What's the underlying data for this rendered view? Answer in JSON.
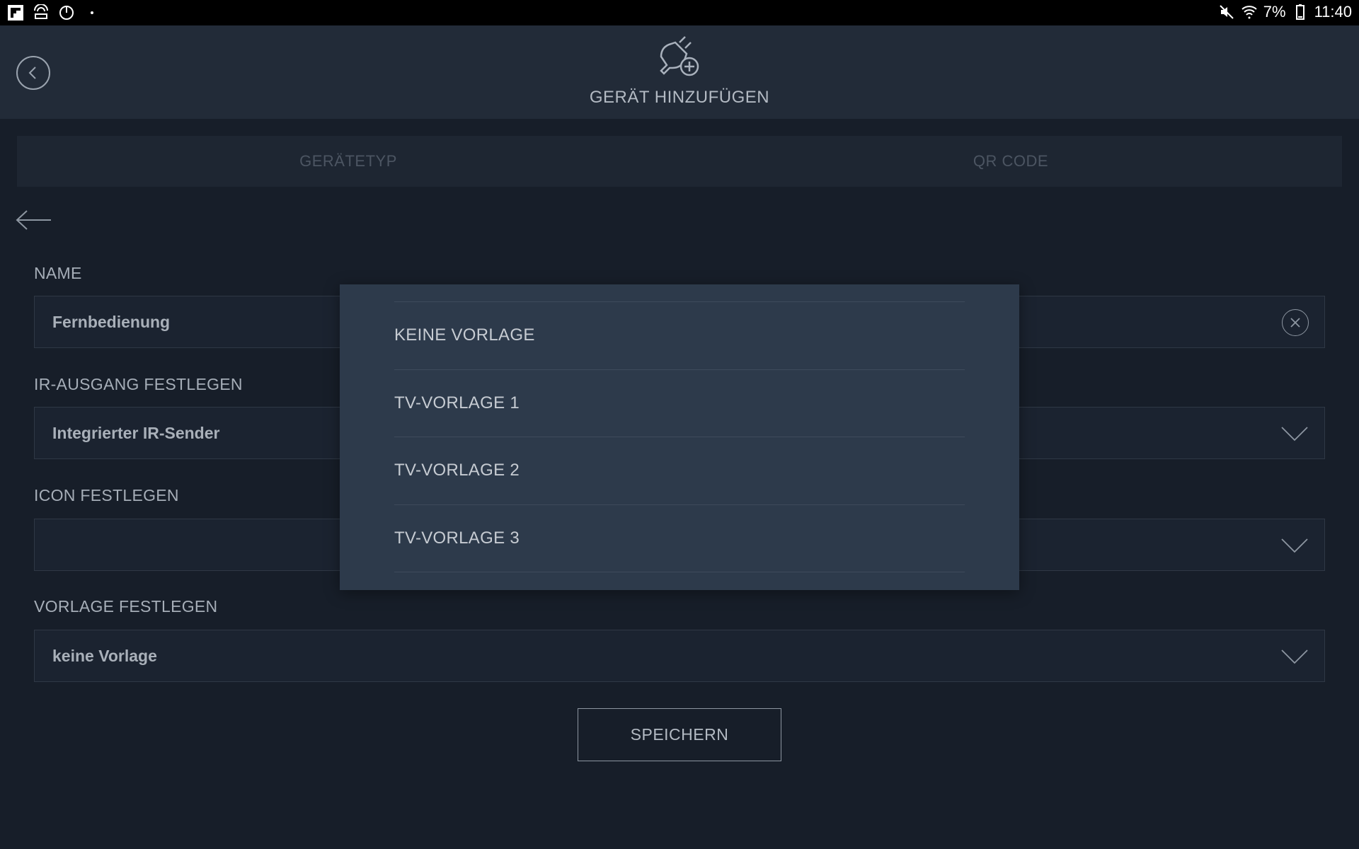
{
  "status_bar": {
    "left_icons": [
      "flipboard-icon",
      "screen-mirror-icon",
      "sync-icon",
      "dot-icon"
    ],
    "right_icons": [
      "mute-icon",
      "wifi-icon",
      "battery-icon"
    ],
    "battery": "7%",
    "time": "11:40"
  },
  "header": {
    "title": "GERÄT HINZUFÜGEN",
    "icon": "plug-add-icon"
  },
  "tabs": [
    {
      "label": "GERÄTETYP"
    },
    {
      "label": "QR CODE"
    }
  ],
  "form": {
    "name": {
      "label": "NAME",
      "value": "Fernbedienung"
    },
    "ir_output": {
      "label": "IR-AUSGANG FESTLEGEN",
      "value": "Integrierter IR-Sender"
    },
    "icon": {
      "label": "ICON FESTLEGEN",
      "value": ""
    },
    "template": {
      "label": "VORLAGE FESTLEGEN",
      "value": "keine Vorlage"
    },
    "save_label": "SPEICHERN"
  },
  "dialog": {
    "options": [
      {
        "label": "KEINE VORLAGE"
      },
      {
        "label": "TV-VORLAGE 1"
      },
      {
        "label": "TV-VORLAGE 2"
      },
      {
        "label": "TV-VORLAGE 3"
      }
    ]
  },
  "colors": {
    "background": "#171e29",
    "header": "#222b38",
    "dialog": "#2d3a4b",
    "text": "#b3bac3"
  }
}
